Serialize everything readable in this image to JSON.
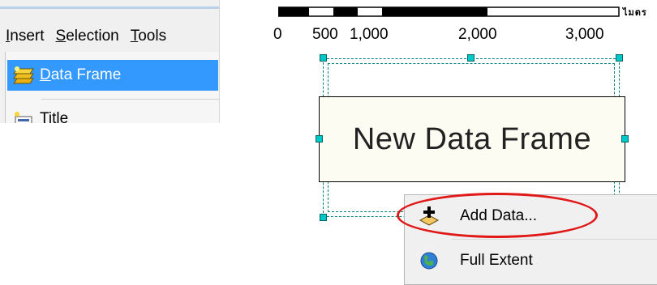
{
  "menubar": {
    "items": [
      {
        "label_pre": "",
        "label_u": "I",
        "label_post": "nsert"
      },
      {
        "label_pre": "",
        "label_u": "S",
        "label_post": "election"
      },
      {
        "label_pre": "",
        "label_u": "T",
        "label_post": "ools"
      }
    ]
  },
  "dropdown": {
    "selected": {
      "label_u": "D",
      "label_post": "ata Frame",
      "icon": "data-frame-icon"
    },
    "next": {
      "label": "Title",
      "icon": "title-icon"
    }
  },
  "scalebar": {
    "ticks": [
      "0",
      "500",
      "1,000",
      "2,000",
      "3,000"
    ],
    "units": "ไมตร"
  },
  "data_frame": {
    "label": "New Data Frame"
  },
  "context_menu": {
    "items": [
      {
        "label": "Add Data...",
        "icon": "add-data-icon"
      },
      {
        "label": "Full Extent",
        "icon": "globe-icon"
      }
    ]
  },
  "colors": {
    "menu_highlight": "#3399ff",
    "annotation_red": "#e01818",
    "selection_handle": "#00c8c8"
  }
}
